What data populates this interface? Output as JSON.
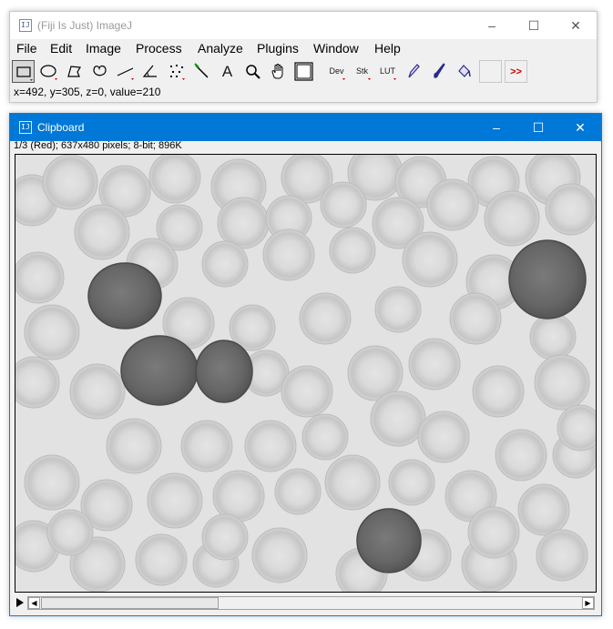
{
  "main_window": {
    "title": "(Fiji Is Just) ImageJ",
    "icon_glyph": "IJ",
    "controls": {
      "minimize": "–",
      "maximize": "☐",
      "close": "✕"
    },
    "menu": [
      "File",
      "Edit",
      "Image",
      "Process",
      "Analyze",
      "Plugins",
      "Window",
      "Help"
    ],
    "tools": {
      "rectangle": "rectangle-icon",
      "oval": "oval-icon",
      "polygon": "polygon-icon",
      "freehand": "freehand-icon",
      "line": "straight-line-icon",
      "angle": "angle-icon",
      "point": "multipoint-icon",
      "wand": "wand-icon",
      "text": "A",
      "magnifier": "magnifier-icon",
      "hand": "hand-icon",
      "color_picker": "color-picker-icon",
      "dev": "Dev",
      "stk": "Stk",
      "lut": "LUT",
      "pencil": "pencil-icon",
      "brush": "brush-icon",
      "flood_fill": "flood-fill-icon",
      "more": ">>"
    },
    "status": "x=492, y=305, z=0, value=210"
  },
  "clipboard_window": {
    "title": "Clipboard",
    "icon_glyph": "IJ",
    "controls": {
      "minimize": "–",
      "maximize": "☐",
      "close": "✕"
    },
    "image_info": "1/3 (Red); 637x480 pixels; 8-bit; 896K",
    "image_content": "grayscale blood smear micrograph",
    "scroll_left": "◀",
    "scroll_right": "▶"
  },
  "colors": {
    "active_titlebar": "#0078d7",
    "arrow_red": "#cc0000",
    "cell_light": "#d4d4d4",
    "cell_dark": "#6e6e6e",
    "background": "#e2e2e2"
  }
}
